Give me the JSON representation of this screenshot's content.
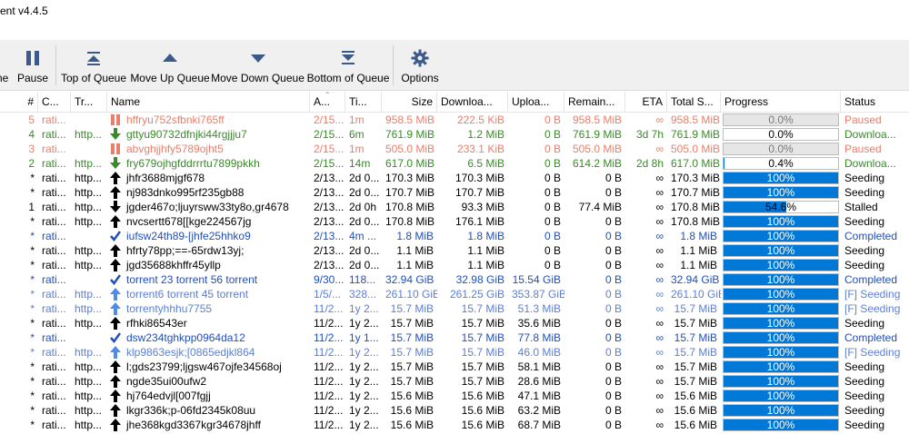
{
  "window": {
    "title": "ent v4.4.5"
  },
  "toolbar": {
    "buttons": [
      {
        "label": "me",
        "icon": "resume-icon"
      },
      {
        "label": "Pause",
        "icon": "pause-icon"
      },
      {
        "label": "Top of Queue",
        "icon": "top-of-queue-icon"
      },
      {
        "label": "Move Up Queue",
        "icon": "move-up-queue-icon"
      },
      {
        "label": "Move Down Queue",
        "icon": "move-down-queue-icon"
      },
      {
        "label": "Bottom of Queue",
        "icon": "bottom-of-queue-icon"
      },
      {
        "label": "Options",
        "icon": "gear-icon"
      }
    ]
  },
  "columns": [
    "#",
    "C...",
    "Tr...",
    "Name",
    "A...",
    "Ti...",
    "Size",
    "Downloa...",
    "Uploa...",
    "Remain...",
    "ETA",
    "Total S...",
    "Progress",
    "Status"
  ],
  "colors": {
    "paused": "#e8806b",
    "downloading": "#3a8a2a",
    "completed": "#1f4fbf",
    "forced_seeding": "#5b7fd6",
    "normal": "#000000",
    "progress_fill": "#0078d7"
  },
  "rows": [
    {
      "q": "5",
      "c": "rati...",
      "t": "",
      "name": "hffryu752sfbnki765ff",
      "a": "2/15...",
      "ti": "1m",
      "size": "958.5 MiB",
      "down": "222.5 KiB",
      "up": "0 B",
      "rem": "958.5 MiB",
      "eta": "∞",
      "total": "958.5 MiB",
      "progress": 0.0,
      "ptext": "0.0%",
      "status": "Paused",
      "state": "paused"
    },
    {
      "q": "4",
      "c": "rati...",
      "t": "http...",
      "name": "gttyu90732dfnjki44rgjjju7",
      "a": "2/15...",
      "ti": "6m",
      "size": "761.9 MiB",
      "down": "1.2 MiB",
      "up": "0 B",
      "rem": "761.9 MiB",
      "eta": "3d 7h",
      "total": "761.9 MiB",
      "progress": 0.0,
      "ptext": "0.0%",
      "status": "Downloa...",
      "state": "downloading"
    },
    {
      "q": "3",
      "c": "rati...",
      "t": "",
      "name": "abvghjjhfy5789ojht5",
      "a": "2/15...",
      "ti": "1m",
      "size": "505.0 MiB",
      "down": "233.1 KiB",
      "up": "0 B",
      "rem": "505.0 MiB",
      "eta": "∞",
      "total": "505.0 MiB",
      "progress": 0.0,
      "ptext": "0.0%",
      "status": "Paused",
      "state": "paused"
    },
    {
      "q": "2",
      "c": "rati...",
      "t": "http...",
      "name": "fry679ojhgfddrrrtu7899pkkh",
      "a": "2/15...",
      "ti": "14m",
      "size": "617.0 MiB",
      "down": "6.5 MiB",
      "up": "0 B",
      "rem": "614.2 MiB",
      "eta": "2d 8h",
      "total": "617.0 MiB",
      "progress": 0.004,
      "ptext": "0.4%",
      "status": "Downloa...",
      "state": "downloading"
    },
    {
      "q": "*",
      "c": "rati...",
      "t": "http...",
      "name": "jhfr3688mjgf678",
      "a": "2/13...",
      "ti": "2d 0...",
      "size": "170.3 MiB",
      "down": "170.3 MiB",
      "up": "0 B",
      "rem": "0 B",
      "eta": "∞",
      "total": "170.3 MiB",
      "progress": 1.0,
      "ptext": "100%",
      "status": "Seeding",
      "state": "seeding"
    },
    {
      "q": "*",
      "c": "rati...",
      "t": "http...",
      "name": "nj983dnko995rf235gb88",
      "a": "2/13...",
      "ti": "2d 0...",
      "size": "170.7 MiB",
      "down": "170.7 MiB",
      "up": "0 B",
      "rem": "0 B",
      "eta": "∞",
      "total": "170.7 MiB",
      "progress": 1.0,
      "ptext": "100%",
      "status": "Seeding",
      "state": "seeding"
    },
    {
      "q": "1",
      "c": "rati...",
      "t": "http...",
      "name": "jgder467o;ljuyrsww33ty8o,gr4678",
      "a": "2/13...",
      "ti": "2d 0h",
      "size": "170.8 MiB",
      "down": "93.3 MiB",
      "up": "0 B",
      "rem": "77.4 MiB",
      "eta": "∞",
      "total": "170.8 MiB",
      "progress": 0.546,
      "ptext": "54.6%",
      "status": "Stalled",
      "state": "stalled"
    },
    {
      "q": "*",
      "c": "rati...",
      "t": "http...",
      "name": "nvcsertt678[[kge224567jg",
      "a": "2/13...",
      "ti": "2d 0...",
      "size": "170.8 MiB",
      "down": "176.1 MiB",
      "up": "0 B",
      "rem": "0 B",
      "eta": "∞",
      "total": "170.8 MiB",
      "progress": 1.0,
      "ptext": "100%",
      "status": "Seeding",
      "state": "seeding"
    },
    {
      "q": "*",
      "c": "rati...",
      "t": "",
      "name": "iufsw24th89-[jhfe25hhko9",
      "a": "2/13...",
      "ti": "4m ...",
      "size": "1.8 MiB",
      "down": "1.8 MiB",
      "up": "0 B",
      "rem": "0 B",
      "eta": "∞",
      "total": "1.8 MiB",
      "progress": 1.0,
      "ptext": "100%",
      "status": "Completed",
      "state": "completed"
    },
    {
      "q": "*",
      "c": "rati...",
      "t": "http...",
      "name": "hfrty78pp;==-65rdw13yj;",
      "a": "2/13...",
      "ti": "2d 0...",
      "size": "1.1 MiB",
      "down": "1.1 MiB",
      "up": "0 B",
      "rem": "0 B",
      "eta": "∞",
      "total": "1.1 MiB",
      "progress": 1.0,
      "ptext": "100%",
      "status": "Seeding",
      "state": "seeding"
    },
    {
      "q": "*",
      "c": "rati...",
      "t": "http...",
      "name": "jgd35688khffr45yllp",
      "a": "2/13...",
      "ti": "2d 0...",
      "size": "1.1 MiB",
      "down": "1.1 MiB",
      "up": "0 B",
      "rem": "0 B",
      "eta": "∞",
      "total": "1.1 MiB",
      "progress": 1.0,
      "ptext": "100%",
      "status": "Seeding",
      "state": "seeding"
    },
    {
      "q": "*",
      "c": "rati...",
      "t": "",
      "name": "torrent 23 torrent 56 torrent",
      "a": "9/30...",
      "ti": "118...",
      "size": "32.94 GiB",
      "down": "32.98 GiB",
      "up": "15.54 GiB",
      "rem": "0 B",
      "eta": "∞",
      "total": "32.94 GiB",
      "progress": 1.0,
      "ptext": "100%",
      "status": "Completed",
      "state": "completed"
    },
    {
      "q": "*",
      "c": "rati...",
      "t": "http...",
      "name": "torrent6 torrent 45 torrent",
      "a": "1/5/...",
      "ti": "328...",
      "size": "261.10 GiB",
      "down": "261.25 GiB",
      "up": "353.87 GiB",
      "rem": "0 B",
      "eta": "∞",
      "total": "261.10 GiB",
      "progress": 1.0,
      "ptext": "100%",
      "status": "[F] Seeding",
      "state": "forced"
    },
    {
      "q": "*",
      "c": "rati...",
      "t": "http...",
      "name": "torrentyhhhu7755",
      "a": "11/2...",
      "ti": "1y 2...",
      "size": "15.7 MiB",
      "down": "15.7 MiB",
      "up": "51.3 MiB",
      "rem": "0 B",
      "eta": "∞",
      "total": "15.7 MiB",
      "progress": 1.0,
      "ptext": "100%",
      "status": "[F] Seeding",
      "state": "forced"
    },
    {
      "q": "*",
      "c": "rati...",
      "t": "http...",
      "name": "rfhki86543er",
      "a": "11/2...",
      "ti": "1y 2...",
      "size": "15.7 MiB",
      "down": "15.7 MiB",
      "up": "35.6 MiB",
      "rem": "0 B",
      "eta": "∞",
      "total": "15.7 MiB",
      "progress": 1.0,
      "ptext": "100%",
      "status": "Seeding",
      "state": "seeding"
    },
    {
      "q": "*",
      "c": "rati...",
      "t": "",
      "name": "dsw234tghkpp0964da12",
      "a": "11/2...",
      "ti": "1y 1...",
      "size": "15.7 MiB",
      "down": "15.7 MiB",
      "up": "77.8 MiB",
      "rem": "0 B",
      "eta": "∞",
      "total": "15.7 MiB",
      "progress": 1.0,
      "ptext": "100%",
      "status": "Completed",
      "state": "completed"
    },
    {
      "q": "*",
      "c": "rati...",
      "t": "http...",
      "name": "klp9863esjk;[0865edjkl864",
      "a": "11/2...",
      "ti": "1y 2...",
      "size": "15.7 MiB",
      "down": "15.7 MiB",
      "up": "46.0 MiB",
      "rem": "0 B",
      "eta": "∞",
      "total": "15.7 MiB",
      "progress": 1.0,
      "ptext": "100%",
      "status": "[F] Seeding",
      "state": "forced"
    },
    {
      "q": "*",
      "c": "rati...",
      "t": "http...",
      "name": "l;gds23799;ljgsw467ojfe34568oj",
      "a": "11/2...",
      "ti": "1y 2...",
      "size": "15.7 MiB",
      "down": "15.7 MiB",
      "up": "58.1 MiB",
      "rem": "0 B",
      "eta": "∞",
      "total": "15.7 MiB",
      "progress": 1.0,
      "ptext": "100%",
      "status": "Seeding",
      "state": "seeding"
    },
    {
      "q": "*",
      "c": "rati...",
      "t": "http...",
      "name": "ngde35ui00ufw2",
      "a": "11/2...",
      "ti": "1y 2...",
      "size": "15.7 MiB",
      "down": "15.7 MiB",
      "up": "28.6 MiB",
      "rem": "0 B",
      "eta": "∞",
      "total": "15.7 MiB",
      "progress": 1.0,
      "ptext": "100%",
      "status": "Seeding",
      "state": "seeding"
    },
    {
      "q": "*",
      "c": "rati...",
      "t": "http...",
      "name": "hj764edvjl[007fgjj",
      "a": "11/2...",
      "ti": "1y 2...",
      "size": "15.6 MiB",
      "down": "15.6 MiB",
      "up": "47.1 MiB",
      "rem": "0 B",
      "eta": "∞",
      "total": "15.6 MiB",
      "progress": 1.0,
      "ptext": "100%",
      "status": "Seeding",
      "state": "seeding"
    },
    {
      "q": "*",
      "c": "rati...",
      "t": "http...",
      "name": "lkgr336k;p-06fd2345k08uu",
      "a": "11/2...",
      "ti": "1y 2...",
      "size": "15.6 MiB",
      "down": "15.6 MiB",
      "up": "63.2 MiB",
      "rem": "0 B",
      "eta": "∞",
      "total": "15.6 MiB",
      "progress": 1.0,
      "ptext": "100%",
      "status": "Seeding",
      "state": "seeding"
    },
    {
      "q": "*",
      "c": "rati...",
      "t": "http...",
      "name": "jhe368kgd3367kgr34678jhff",
      "a": "11/2...",
      "ti": "1y 2...",
      "size": "15.6 MiB",
      "down": "15.6 MiB",
      "up": "68.7 MiB",
      "rem": "0 B",
      "eta": "∞",
      "total": "15.6 MiB",
      "progress": 1.0,
      "ptext": "100%",
      "status": "Seeding",
      "state": "seeding"
    }
  ]
}
